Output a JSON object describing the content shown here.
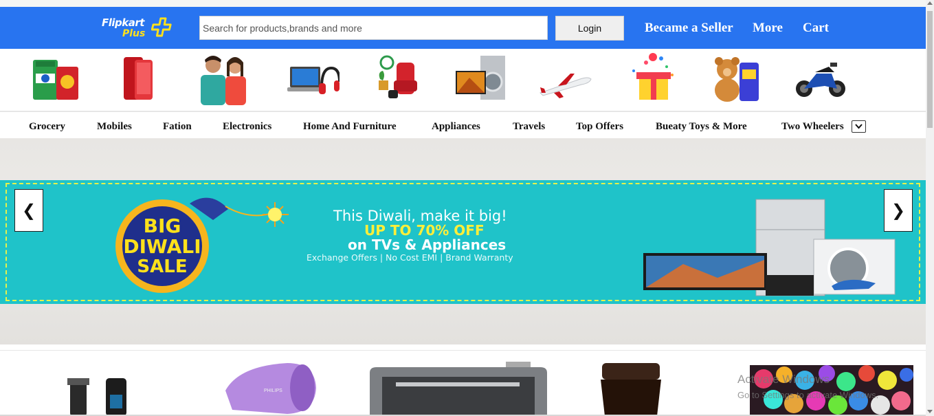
{
  "header": {
    "logo_word": "Flipkart",
    "logo_plus": "Plus",
    "search_placeholder": "Search for products,brands and more",
    "login_label": "Login",
    "links": [
      "Became a Seller",
      "More",
      "Cart"
    ]
  },
  "category_icons": [
    "grocery-icon",
    "mobile-phone-icon",
    "fashion-people-icon",
    "laptop-headphones-icon",
    "furniture-icon",
    "appliances-icon",
    "airplane-icon",
    "gift-icon",
    "teddy-bear-toys-icon",
    "motorcycle-icon"
  ],
  "menu": {
    "items": [
      "Grocery",
      "Mobiles",
      "Fation",
      "Electronics",
      "Home And Furniture",
      "Appliances",
      "Travels",
      "Top Offers",
      "Bueaty Toys & More",
      "Two Wheelers"
    ]
  },
  "banner": {
    "badge_line1": "BIG",
    "badge_line2": "DIWALI",
    "badge_line3": "SALE",
    "line1": "This Diwali, make it big!",
    "line2": "UP TO 70% OFF",
    "line3": "on TVs & Appliances",
    "line4": "Exchange Offers | No Cost EMI | Brand Warranty",
    "prev_arrow": "❮",
    "next_arrow": "❯"
  },
  "products": [
    "trimmer-icon",
    "hair-dryer-icon",
    "printer-icon",
    "coffee-jar-icon",
    "colorful-balls-image"
  ],
  "watermark": {
    "line1": "Activate Windows",
    "line2": "Go to Settings to activate Windows."
  },
  "colors": {
    "header_bg": "#2874f0",
    "banner_bg": "#1fc3c9",
    "accent_yellow": "#ffe11b"
  }
}
